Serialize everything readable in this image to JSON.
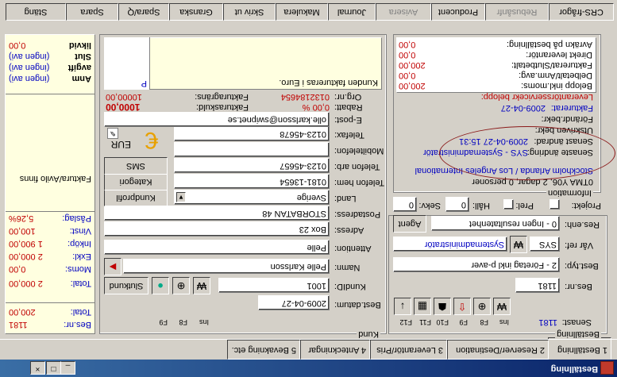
{
  "window": {
    "title": "Beställning"
  },
  "window_buttons": {
    "minimize": "_",
    "maximize": "□",
    "close": "×"
  },
  "top_tabs": [
    "1 Beställning",
    "2 Reserver/Destination",
    "3 Leverantör/Pris",
    "4 Anteckningar",
    "5 Bevakning etc."
  ],
  "bottom_buttons": [
    "CRS-frågor",
    "Rebusånfr",
    "Producent",
    "Avisera",
    "Journal",
    "Makulera",
    "Skriv ut",
    "Granska",
    "Spara/Q",
    "Spara",
    "Stäng"
  ],
  "order": {
    "group_label": "Beställning",
    "sent_label": "Senast:",
    "sent_value": "1181",
    "fkeys": [
      "Ins",
      "F8",
      "F9",
      "F10",
      "F11",
      "F12"
    ],
    "order_nr_label": "Bes.nr:",
    "order_nr_value": "1181",
    "order_type_label": "Best.typ:",
    "order_type_value": "2 - Företag inkl p-aver",
    "handler_label": "Vår ref:",
    "handler_code": "SYS",
    "handler_name": "Systemadministratör",
    "status_label": "Res.enh:",
    "status_value": "0 - Ingen resultatenhet",
    "agent_button": "Agent",
    "project_label": "Projekt:",
    "prel_label": "Prel:",
    "hall_label": "Håll:",
    "hall_value": "0",
    "sekv_label": "Sekv:",
    "sekv_value": "0"
  },
  "info": {
    "group_label": "Information",
    "lines": [
      "0TMA Y06, 2 dagar, 0 personer",
      "Stockholm Arlanda / Los Angeles International"
    ],
    "created_label": "Senaste ändring:",
    "created_value": "SYS - Systemadministratör",
    "changed_label": "Senast ändrad:",
    "changed_value": "2009-04-27 15:31",
    "delivery_label": "Utskriven bekr:",
    "print_label": "Förändr.bekr:",
    "invoice_label": "Fakturerat:",
    "invoice_value": "2009-04-27",
    "service_label": "Leverantörsservicekr belopp:",
    "service_value": ""
  },
  "amounts": {
    "rows": [
      {
        "label": "Belopp inkl.moms:",
        "value": "200,00"
      },
      {
        "label": "Delbetalt/Anm.avg:",
        "value": "0,00"
      },
      {
        "label": "Fakturerat/Slutbetalt:",
        "value": "200,00"
      },
      {
        "label": "Direkt leverantör:",
        "value": "0,00"
      },
      {
        "label": "Avräkn på beställning:",
        "value": "0,00"
      }
    ]
  },
  "customer": {
    "group_label": "Kund",
    "order_date_label": "Best.datum:",
    "order_date_value": "2009-04-27",
    "customer_id_label": "KundID:",
    "customer_id_value": "1001",
    "fkeys": [
      "Ins",
      "F8",
      "F9"
    ],
    "customer_button": "Slutkund",
    "name_label": "Namn:",
    "name_value": "Pelle Karlsson",
    "attention_label": "Attention:",
    "attention_value": "Pelle",
    "address_label": "Adress:",
    "address_value": "Box 23",
    "postal_label": "Postadress:",
    "postal_value": "STORBATAN 48",
    "country_label": "Land:",
    "country_value": "Sverige",
    "profile_button": "Kundprofil",
    "phone_home_label": "Telefon hem:",
    "phone_home_value": "0181-13654",
    "category_button": "Kategori",
    "phone_work_label": "Telefon arb:",
    "phone_work_value": "0123-45657",
    "sms_button": "SMS",
    "mobile_label": "Mobiltelefon:",
    "mobile_value": "",
    "fax_label": "Telefax:",
    "fax_value": "0123-45678",
    "currency_value": "EUR",
    "email_label": "E-post:",
    "email_value": "olle.karlsson@swipnet.se",
    "rabatt_label": "Rabatt:",
    "rabatt_value": "0,00 %",
    "orgnr_label": "Org.nr:",
    "orgnr_value": "0132184654",
    "credit_label": "Fakturaskuld:",
    "credit_value": "1000,00",
    "limit_label": "Fakturagräns:",
    "limit_value": "10000,00",
    "note_text": "Kunden faktureras i Euro.",
    "note_marker": "P"
  },
  "totals": {
    "order_nr_label": "Bes.nr:",
    "order_nr_value": "1181",
    "total_label": "Total:",
    "total_value": "200,00",
    "rows": [
      {
        "label": "Total:",
        "value": "2 000,00"
      },
      {
        "label": "Moms:",
        "value": "0,00"
      },
      {
        "label": "Exkl:",
        "value": "2 000,00"
      },
      {
        "label": "Inköp:",
        "value": "1 900,00"
      },
      {
        "label": "Vinst:",
        "value": "100,00"
      },
      {
        "label": "Påslag:",
        "value": "5,26%"
      }
    ],
    "note_text": "Faktura/Avilo finns",
    "bottom_rows": [
      {
        "label": "Anm",
        "value": "(ingen avi)"
      },
      {
        "label": "avgift",
        "value": "(ingen avi)"
      },
      {
        "label": "Slut",
        "value": "(ingen avi)"
      },
      {
        "label": "likvid",
        "value": "0,00"
      }
    ]
  },
  "colors": {
    "titlebar": "#0a246a",
    "accent_red": "#c00000",
    "label_blue": "#0000c0",
    "note_bg": "#ffffe0",
    "highlight_ellipse": "#8b1a1a"
  }
}
